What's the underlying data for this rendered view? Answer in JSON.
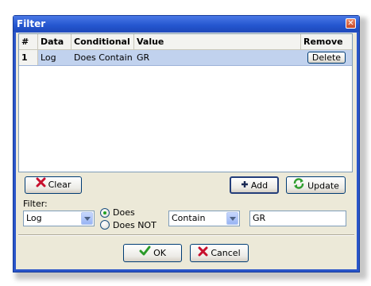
{
  "window": {
    "title": "Filter",
    "close_glyph": "✕"
  },
  "grid": {
    "columns": [
      "#",
      "Data",
      "Conditional",
      "Value",
      "Remove"
    ],
    "rows": [
      {
        "num": "1",
        "data": "Log",
        "conditional": "Does Contain",
        "value": "GR",
        "remove_label": "Delete"
      }
    ]
  },
  "buttons": {
    "clear": "Clear",
    "add": "Add",
    "update": "Update",
    "ok": "OK",
    "cancel": "Cancel"
  },
  "filter": {
    "label": "Filter:",
    "field_selected": "Log",
    "radio_does": "Does",
    "radio_does_not": "Does NOT",
    "radio_selected": "Does",
    "condition_selected": "Contain",
    "value": "GR"
  },
  "colors": {
    "titlebar": "#2456cf",
    "selection": "#c1d2ee",
    "client": "#ece9d8"
  },
  "icons": {
    "clear": "red-x-icon",
    "add": "plus-icon",
    "update": "refresh-icon",
    "ok": "checkmark-icon",
    "cancel": "red-x-icon"
  }
}
